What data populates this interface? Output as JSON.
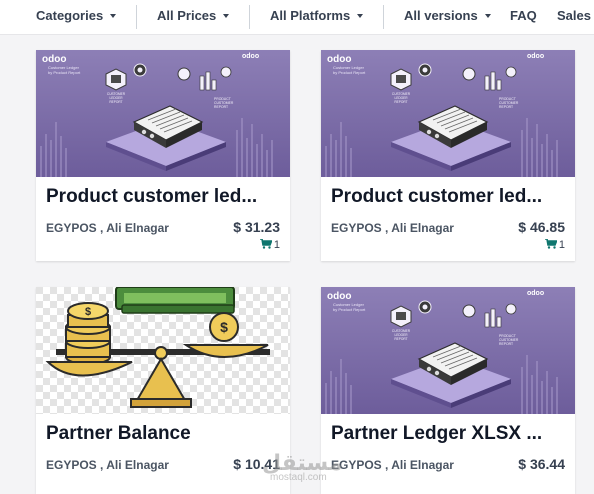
{
  "filters": [
    {
      "label": "Categories",
      "has_caret": true
    },
    {
      "label": "All Prices",
      "has_caret": true
    },
    {
      "label": "All Platforms",
      "has_caret": true
    },
    {
      "label": "All versions",
      "has_caret": true
    }
  ],
  "nav": {
    "faq": "FAQ",
    "sales": "Sales"
  },
  "thumb_text": {
    "brand": "odoo",
    "subtitle_line1": "Customer Ledger",
    "subtitle_line2": "by Product Report",
    "badge_line1": "CUSTOMER",
    "badge_line2": "LEDGER",
    "badge_line3": "REPORT",
    "side_line1": "PRODUCT",
    "side_line2": "CUSTOMER",
    "side_line3": "REPORT"
  },
  "products": [
    {
      "title": "Product customer led...",
      "author": "EGYPOS , Ali Elnagar",
      "price": "$ 31.23",
      "sales": "1",
      "thumb": "ledger"
    },
    {
      "title": "Product customer led...",
      "author": "EGYPOS , Ali Elnagar",
      "price": "$ 46.85",
      "sales": "1",
      "thumb": "ledger"
    },
    {
      "title": "Partner Balance",
      "author": "EGYPOS , Ali Elnagar",
      "price": "$ 10.41",
      "sales": "",
      "thumb": "balance"
    },
    {
      "title": "Partner Ledger XLSX ...",
      "author": "EGYPOS , Ali Elnagar",
      "price": "$ 36.44",
      "sales": "",
      "thumb": "ledger"
    }
  ],
  "watermark": {
    "main": "مستقل",
    "sub": "mostaql.com"
  },
  "colors": {
    "accent_green": "#0f766e",
    "thumb_purple": "#7a6aa6"
  }
}
